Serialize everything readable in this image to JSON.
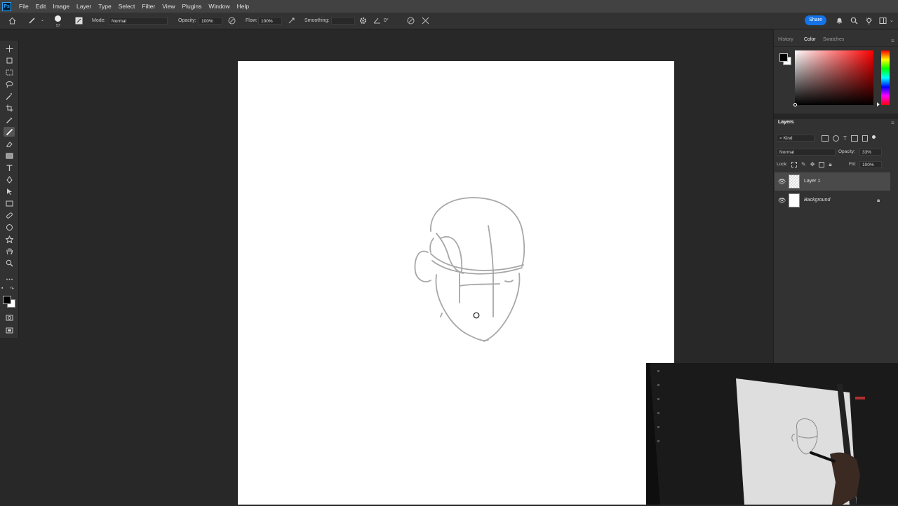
{
  "menubar": {
    "items": [
      "File",
      "Edit",
      "Image",
      "Layer",
      "Type",
      "Select",
      "Filter",
      "View",
      "Plugins",
      "Window",
      "Help"
    ],
    "share_label": "Share",
    "logo": "Ps"
  },
  "options_bar": {
    "brush_size": "57",
    "mode_label": "Mode:",
    "mode_value": "Normal",
    "opacity_label": "Opacity:",
    "opacity_value": "100%",
    "flow_label": "Flow:",
    "flow_value": "100%",
    "smoothing_label": "Smoothing:",
    "smoothing_value": "",
    "angle_value": "0°"
  },
  "color_panel": {
    "tabs": [
      "History",
      "Color",
      "Swatches"
    ],
    "active_tab": "Color",
    "foreground": "#000000",
    "background": "#ffffff"
  },
  "layers_panel": {
    "title": "Layers",
    "filter_label": "Kind",
    "blend_mode": "Normal",
    "opacity_label": "Opacity:",
    "opacity_value": "33%",
    "lock_label": "Lock:",
    "fill_label": "Fill:",
    "fill_value": "100%",
    "layers": [
      {
        "name": "Layer 1",
        "selected": true,
        "locked": false
      },
      {
        "name": "Background",
        "selected": false,
        "locked": true
      }
    ]
  },
  "colors": {
    "accent": "#1473e6",
    "ps_blue": "#31a8ff",
    "sketch_stroke": "#a8a8a8"
  }
}
